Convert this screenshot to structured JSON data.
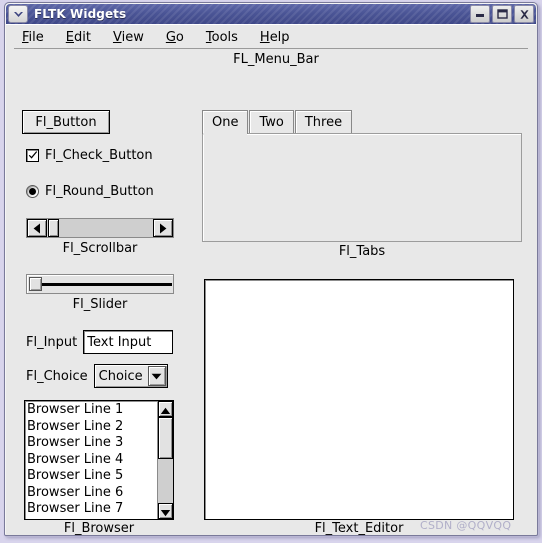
{
  "window": {
    "title": "FLTK Widgets",
    "menu_icon": "chevron-down-icon",
    "controls": {
      "minimize": "minimize-icon",
      "maximize": "maximize-icon",
      "close": "close-icon"
    }
  },
  "menu_bar": {
    "label": "FL_Menu_Bar",
    "items": [
      {
        "mnemonic": "F",
        "rest": "ile"
      },
      {
        "mnemonic": "E",
        "rest": "dit"
      },
      {
        "mnemonic": "V",
        "rest": "iew"
      },
      {
        "mnemonic": "G",
        "rest": "o"
      },
      {
        "mnemonic": "T",
        "rest": "ools"
      },
      {
        "mnemonic": "H",
        "rest": "elp"
      }
    ]
  },
  "widgets": {
    "button": {
      "text": "Fl_Button"
    },
    "check_button": {
      "label": "Fl_Check_Button",
      "checked": true
    },
    "round_button": {
      "label": "Fl_Round_Button",
      "selected": true
    },
    "scrollbar": {
      "label": "Fl_Scrollbar",
      "left_arrow": "arrow-left-icon",
      "right_arrow": "arrow-right-icon"
    },
    "slider": {
      "label": "Fl_Slider"
    },
    "input": {
      "label": "Fl_Input",
      "value": "Text Input"
    },
    "choice": {
      "label": "Fl_Choice",
      "value": "Choice",
      "arrow": "chevron-down-icon"
    },
    "browser": {
      "label": "Fl_Browser",
      "lines": [
        "Browser Line 1",
        "Browser Line 2",
        "Browser Line 3",
        "Browser Line 4",
        "Browser Line 5",
        "Browser Line 6",
        "Browser Line 7"
      ],
      "up_arrow": "arrow-up-icon",
      "down_arrow": "arrow-down-icon"
    },
    "tabs": {
      "label": "Fl_Tabs",
      "items": [
        {
          "label": "One",
          "active": true
        },
        {
          "label": "Two",
          "active": false
        },
        {
          "label": "Three",
          "active": false
        }
      ]
    },
    "text_editor": {
      "label": "Fl_Text_Editor",
      "value": ""
    }
  },
  "watermark": {
    "text": "CSDN @QQVQQ"
  },
  "colors": {
    "titlebar": "#4b5596",
    "face": "#e8e8e8",
    "field": "#ffffff",
    "desktop": "#d8d4ec"
  }
}
